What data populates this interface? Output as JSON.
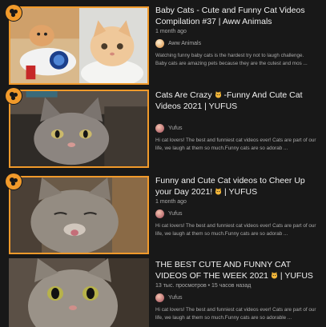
{
  "videos": [
    {
      "title": "Baby Cats - Cute and Funny Cat Videos Compilation #37 | Aww Animals",
      "meta": "1 month ago",
      "channel": "Aww Animals",
      "description_lines": [
        "Watching funny baby cats is the hardest try not to laugh challenge.",
        "Baby cats are amazing pets because they are the cutest and mos ..."
      ]
    },
    {
      "title_pre": "Cats Are Crazy ",
      "title_post": " -Funny And Cute Cat Videos 2021 | YUFUS",
      "meta": "",
      "channel": "Yufus",
      "description_lines": [
        "Hi cat lovers! The best and funniest cat videos ever! Cats are part of our",
        "life, we laugh at them so much.Funny cats are so adorab ..."
      ]
    },
    {
      "title": "Funny and Cute Cat videos to Cheer Up your Day 2021!",
      "title_post": " | YUFUS",
      "meta": "1 month ago",
      "channel": "Yufus",
      "description_lines": [
        "Hi cat lovers! The best and funniest cat videos ever! Cats are part of our",
        "life, we laugh at them so much.Funny cats are so adorab ..."
      ]
    },
    {
      "title": "THE BEST CUTE AND FUNNY CAT VIDEOS OF THE WEEK 2021",
      "title_post": " | YUFUS",
      "meta": "13 тыс. просмотров • 15 часов назад",
      "channel": "Yufus",
      "description_lines": [
        "Hi cat lovers! The best and funniest cat videos ever! Cats are part of our",
        "life, we laugh at them so much.Funny cats are so adorable ..."
      ]
    }
  ],
  "icons": {
    "badge": "watch-later-icon",
    "title_emoji": "cat-face-emoji"
  },
  "colors": {
    "accent": "#f19a2b",
    "background": "#181818",
    "title": "#f1f1f1",
    "secondary": "#aaaaaa"
  }
}
